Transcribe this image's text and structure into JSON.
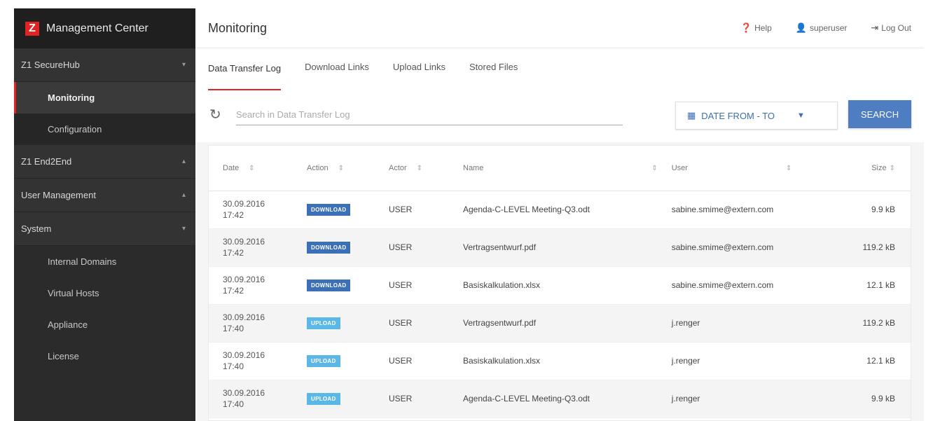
{
  "app": {
    "title": "Management Center",
    "logo_letter": "Z"
  },
  "sidebar": {
    "sections": [
      {
        "label": "Z1 SecureHub",
        "chevron": "⌄"
      },
      {
        "label": "Z1 End2End",
        "chevron": "⌃"
      },
      {
        "label": "User Management",
        "chevron": "⌃"
      },
      {
        "label": "System",
        "chevron": "⌄"
      }
    ],
    "securehub_items": [
      {
        "label": "Monitoring"
      },
      {
        "label": "Configuration"
      }
    ],
    "system_items": [
      {
        "label": "Internal Domains"
      },
      {
        "label": "Virtual Hosts"
      },
      {
        "label": "Appliance"
      },
      {
        "label": "License"
      }
    ]
  },
  "header": {
    "page_title": "Monitoring",
    "help_label": "Help",
    "user_label": "superuser",
    "logout_label": "Log Out"
  },
  "tabs": [
    {
      "label": "Data Transfer Log"
    },
    {
      "label": "Download Links"
    },
    {
      "label": "Upload Links"
    },
    {
      "label": "Stored Files"
    }
  ],
  "toolbar": {
    "search_placeholder": "Search in Data Transfer Log",
    "date_label": "DATE FROM - TO",
    "search_button": "SEARCH"
  },
  "table": {
    "columns": [
      "Date",
      "Action",
      "Actor",
      "Name",
      "User",
      "Size"
    ],
    "rows": [
      {
        "date": "30.09.2016",
        "time": "17:42",
        "action": "DOWNLOAD",
        "actor": "USER",
        "name": "Agenda-C-LEVEL Meeting-Q3.odt",
        "user": "sabine.smime@extern.com",
        "size": "9.9 kB"
      },
      {
        "date": "30.09.2016",
        "time": "17:42",
        "action": "DOWNLOAD",
        "actor": "USER",
        "name": "Vertragsentwurf.pdf",
        "user": "sabine.smime@extern.com",
        "size": "119.2 kB"
      },
      {
        "date": "30.09.2016",
        "time": "17:42",
        "action": "DOWNLOAD",
        "actor": "USER",
        "name": "Basiskalkulation.xlsx",
        "user": "sabine.smime@extern.com",
        "size": "12.1 kB"
      },
      {
        "date": "30.09.2016",
        "time": "17:40",
        "action": "UPLOAD",
        "actor": "USER",
        "name": "Vertragsentwurf.pdf",
        "user": "j.renger",
        "size": "119.2 kB"
      },
      {
        "date": "30.09.2016",
        "time": "17:40",
        "action": "UPLOAD",
        "actor": "USER",
        "name": "Basiskalkulation.xlsx",
        "user": "j.renger",
        "size": "12.1 kB"
      },
      {
        "date": "30.09.2016",
        "time": "17:40",
        "action": "UPLOAD",
        "actor": "USER",
        "name": "Agenda-C-LEVEL Meeting-Q3.odt",
        "user": "j.renger",
        "size": "9.9 kB"
      }
    ]
  },
  "colors": {
    "accent": "#e02424",
    "download_badge": "#3b6fb6",
    "upload_badge": "#5bb8e6",
    "primary_button": "#4e7dc2"
  }
}
